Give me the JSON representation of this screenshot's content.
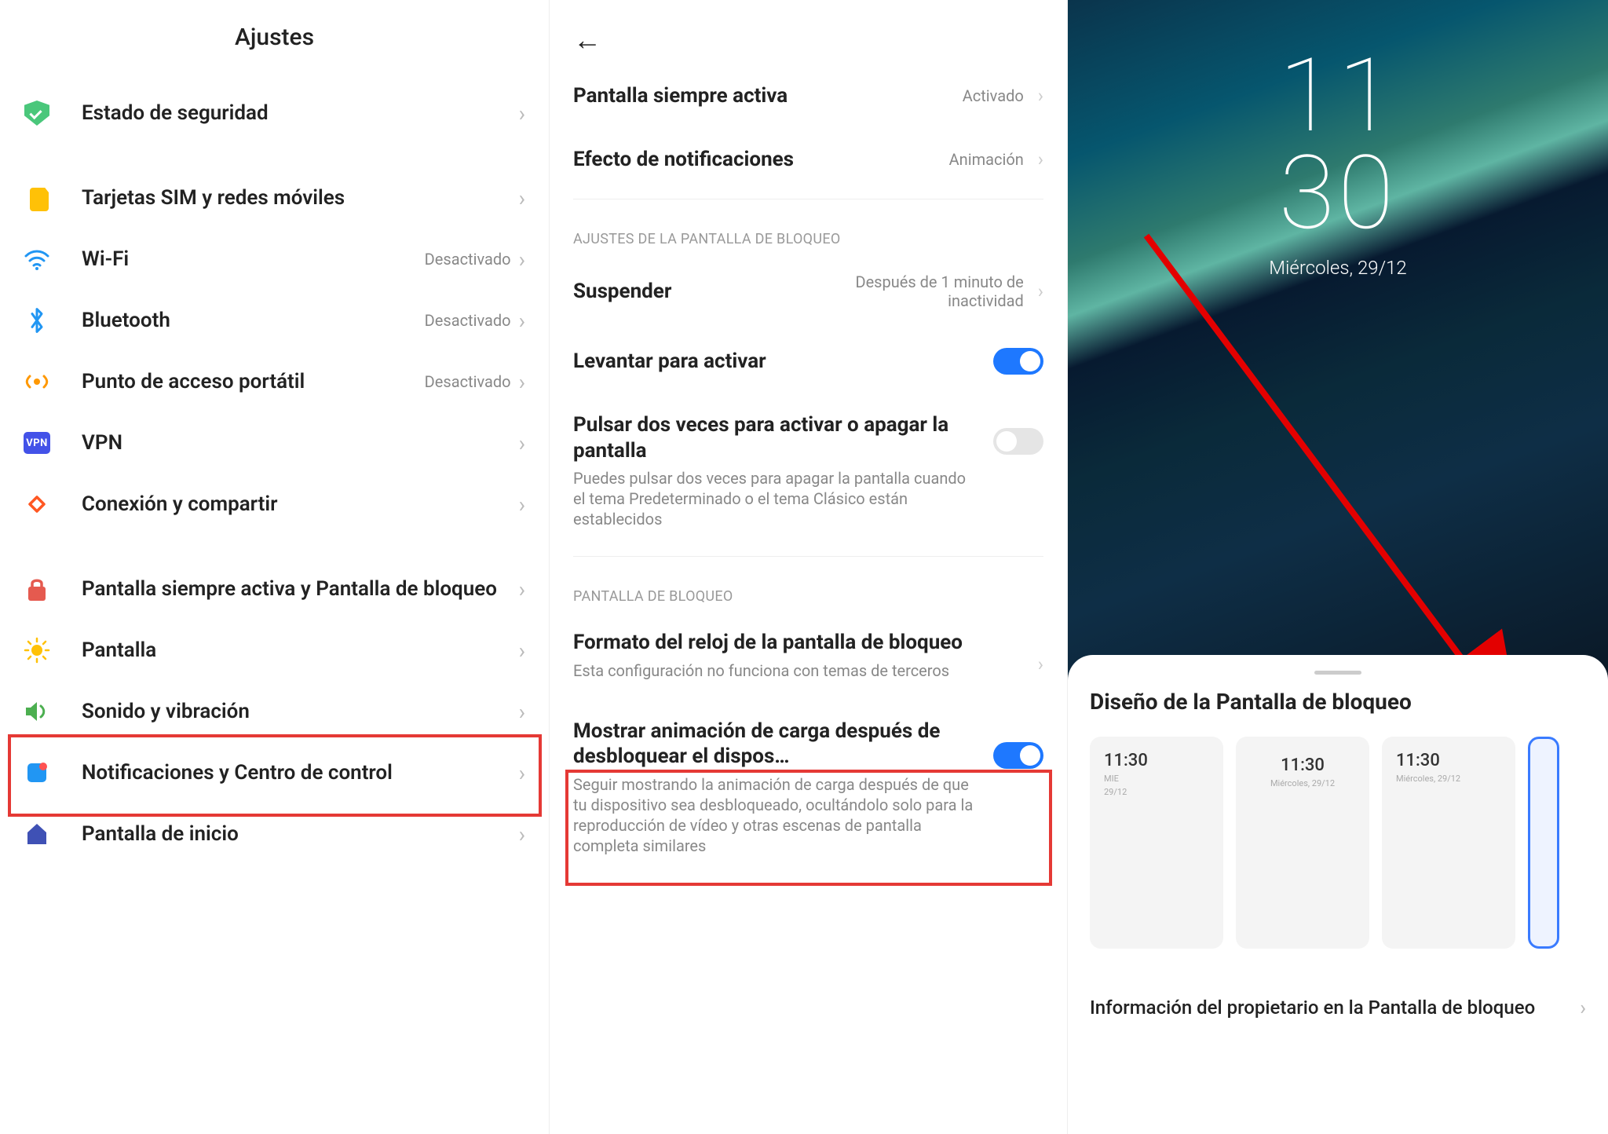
{
  "col1": {
    "title": "Ajustes",
    "items": [
      {
        "label": "Estado de seguridad",
        "status": ""
      },
      {
        "label": "Tarjetas SIM y redes móviles",
        "status": ""
      },
      {
        "label": "Wi-Fi",
        "status": "Desactivado"
      },
      {
        "label": "Bluetooth",
        "status": "Desactivado"
      },
      {
        "label": "Punto de acceso portátil",
        "status": "Desactivado"
      },
      {
        "label": "VPN",
        "status": ""
      },
      {
        "label": "Conexión y compartir",
        "status": ""
      },
      {
        "label": "Pantalla siempre activa y Pantalla de bloqueo",
        "status": ""
      },
      {
        "label": "Pantalla",
        "status": ""
      },
      {
        "label": "Sonido y vibración",
        "status": ""
      },
      {
        "label": "Notificaciones y Centro de control",
        "status": ""
      },
      {
        "label": "Pantalla de inicio",
        "status": ""
      }
    ]
  },
  "col2": {
    "aod": {
      "title": "Pantalla siempre activa",
      "value": "Activado"
    },
    "notif": {
      "title": "Efecto de notificaciones",
      "value": "Animación"
    },
    "sec_lock_settings": "AJUSTES DE LA PANTALLA DE BLOQUEO",
    "sleep": {
      "title": "Suspender",
      "value": "Después de 1 minuto de inactividad"
    },
    "raise": {
      "title": "Levantar para activar"
    },
    "double_tap": {
      "title": "Pulsar dos veces para activar o apagar la pantalla",
      "sub": "Puedes pulsar dos veces para apagar la pantalla cuando el tema Predeterminado o el tema Clásico están establecidos"
    },
    "sec_lock": "PANTALLA DE BLOQUEO",
    "clock_format": {
      "title": "Formato del reloj de la pantalla de bloqueo",
      "sub": "Esta configuración no funciona con temas de terceros"
    },
    "charge_anim": {
      "title": "Mostrar animación de carga después de desbloquear el dispos…",
      "sub": "Seguir mostrando la animación de carga después de que tu dispositivo sea desbloqueado, ocultándolo solo para la reproducción de vídeo y otras escenas de pantalla completa similares"
    }
  },
  "col3": {
    "clock_h": "11",
    "clock_m": "30",
    "date": "Miércoles, 29/12",
    "sheet_title": "Diseño de la Pantalla de bloqueo",
    "layouts": [
      {
        "time": "11:30",
        "line1": "MIE",
        "line2": "29/12",
        "align": "left"
      },
      {
        "time": "11:30",
        "line1": "Miércoles, 29/12",
        "line2": "",
        "align": "center"
      },
      {
        "time": "11:30",
        "line1": "Miércoles, 29/12",
        "line2": "",
        "align": "left"
      }
    ],
    "owner": "Información del propietario en la Pantalla de bloqueo"
  }
}
